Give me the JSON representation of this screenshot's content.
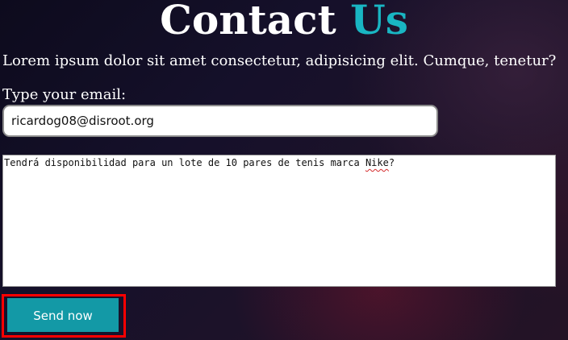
{
  "header": {
    "title_main": "Contact",
    "title_accent": "Us",
    "accent_color": "#19b6c3"
  },
  "intro": {
    "text": "Lorem ipsum dolor sit amet consectetur, adipisicing elit. Cumque, tenetur?"
  },
  "form": {
    "email_label": "Type your email:",
    "email_value": "ricardog08@disroot.org",
    "message_before": "Tendrá disponibilidad para un lote de 10 pares de tenis marca ",
    "message_misspelled": "Nike",
    "message_after": "?",
    "send_label": "Send now",
    "send_color": "#1399a6",
    "highlight_color": "#ff0000"
  }
}
